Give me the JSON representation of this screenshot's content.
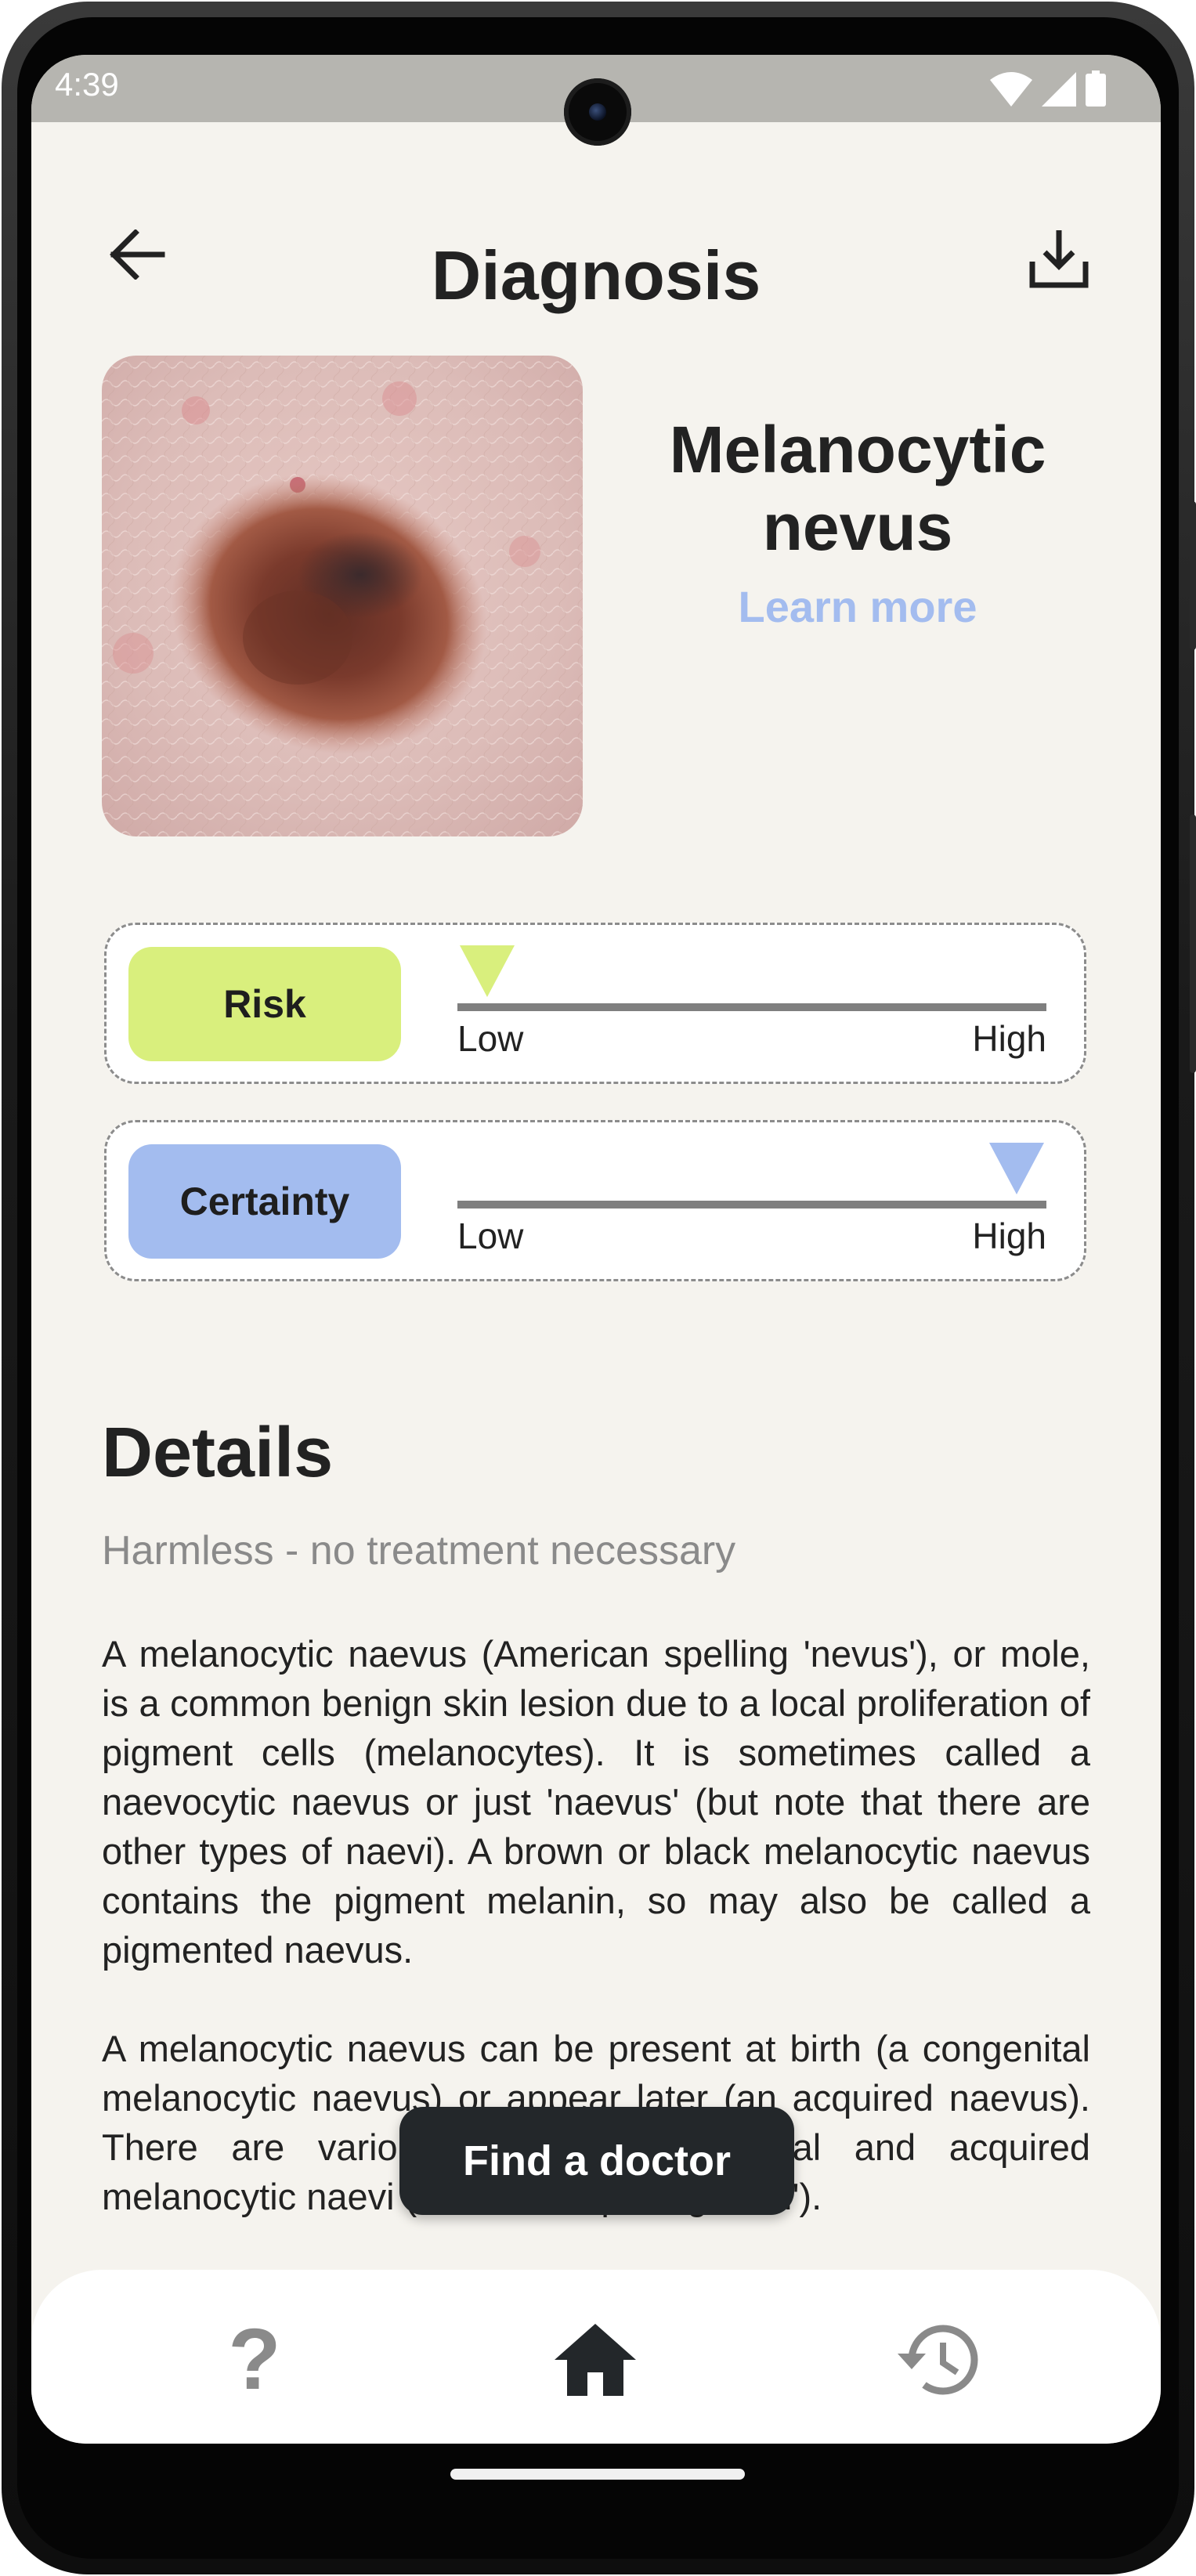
{
  "status_bar": {
    "time": "4:39",
    "icons": [
      "wifi-icon",
      "cellular-signal-icon",
      "battery-icon"
    ]
  },
  "header": {
    "title": "Diagnosis",
    "back_icon": "arrow-back-icon",
    "download_icon": "download-icon"
  },
  "diagnosis": {
    "name": "Melanocytic nevus",
    "learn_more": "Learn more",
    "image_alt": "skin lesion photo"
  },
  "meters": {
    "risk": {
      "label": "Risk",
      "low": "Low",
      "high": "High",
      "level": 0.05,
      "color": "#d9ef7d"
    },
    "certainty": {
      "label": "Certainty",
      "low": "Low",
      "high": "High",
      "level": 0.95,
      "color": "#a3bcef"
    }
  },
  "details": {
    "heading": "Details",
    "subtitle": "Harmless - no treatment necessary",
    "paragraphs": [
      "A melanocytic naevus (American spelling 'nevus'), or mole, is a common benign skin lesion due to a local proliferation of pigment cells (melanocytes). It is sometimes called a naevocytic naevus or just 'naevus' (but note that there are other types of naevi). A brown or black melanocytic naevus contains the pigment melanin, so may also be called a pigmented naevus.",
      "A melanocytic naevus can be present at birth (a congenital melanocytic naevus) or appear later (an acquired naevus). There are various kinds of congenital and acquired melanocytic naevi (American spelling 'nevi')."
    ]
  },
  "actions": {
    "find_doctor": "Find a doctor"
  },
  "bottom_nav": {
    "help_glyph": "?",
    "items": [
      {
        "name": "help",
        "icon": "question-mark-icon"
      },
      {
        "name": "home",
        "icon": "home-icon"
      },
      {
        "name": "history",
        "icon": "history-icon"
      }
    ]
  },
  "colors": {
    "background": "#f5f3ee",
    "accent_blue": "#a3bcef",
    "accent_green": "#d9ef7d",
    "dark_button": "#23272a"
  }
}
